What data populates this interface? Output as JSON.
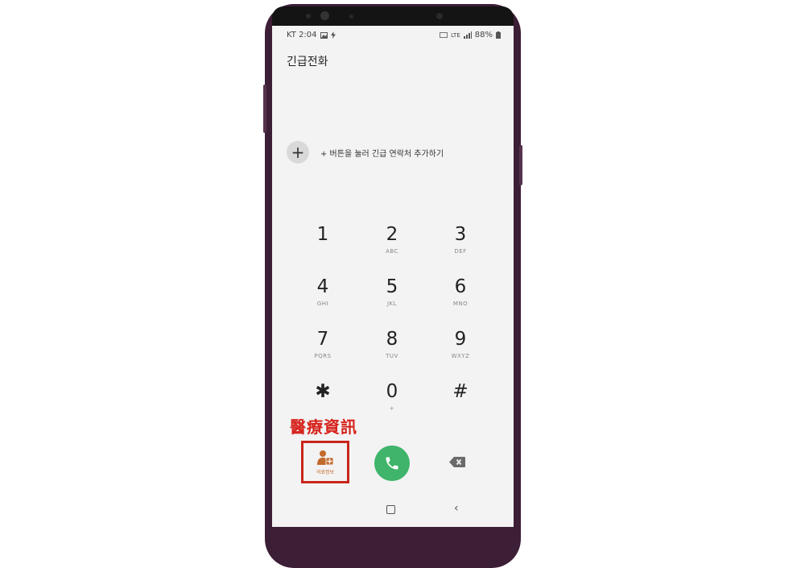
{
  "status": {
    "carrier_time": "KT 2:04",
    "signal_text": "LTE",
    "battery": "88%"
  },
  "title": "긴급전화",
  "add_contact": {
    "button": "+",
    "text": "+ 버튼을 눌러 긴급 연락처 추가하기"
  },
  "keypad": [
    {
      "digit": "1",
      "letters": ""
    },
    {
      "digit": "2",
      "letters": "ABC"
    },
    {
      "digit": "3",
      "letters": "DEF"
    },
    {
      "digit": "4",
      "letters": "GHI"
    },
    {
      "digit": "5",
      "letters": "JKL"
    },
    {
      "digit": "6",
      "letters": "MNO"
    },
    {
      "digit": "7",
      "letters": "PQRS"
    },
    {
      "digit": "8",
      "letters": "TUV"
    },
    {
      "digit": "9",
      "letters": "WXYZ"
    },
    {
      "digit": "✱",
      "letters": ""
    },
    {
      "digit": "0",
      "letters": "+"
    },
    {
      "digit": "#",
      "letters": ""
    }
  ],
  "bottom": {
    "medical_label": "의료정보",
    "annotation": "醫療資訊"
  },
  "colors": {
    "call_green": "#3fb46a",
    "annotation_red": "#d6231c",
    "medical_orange": "#c26a2b",
    "phone_body": "#3c1e36"
  },
  "icons": {
    "medical": "person-medical-icon",
    "call": "phone-icon",
    "backspace": "backspace-icon",
    "home": "home-square-icon",
    "back": "chevron-left-icon"
  }
}
